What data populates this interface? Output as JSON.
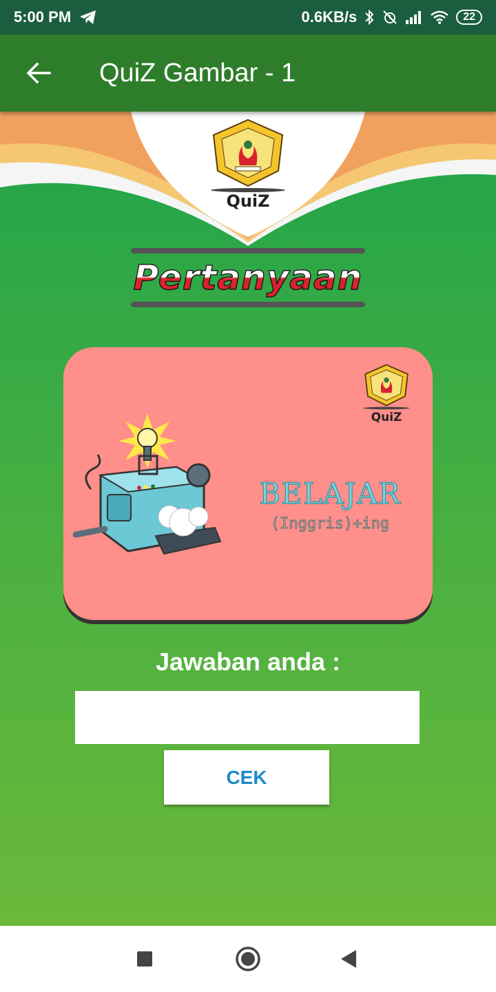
{
  "status_bar": {
    "time": "5:00 PM",
    "network_speed": "0.6KB/s",
    "battery": "22",
    "icons": [
      "telegram-icon",
      "bluetooth-icon",
      "alarm-off-icon",
      "signal-icon",
      "wifi-icon",
      "battery-icon"
    ]
  },
  "app_bar": {
    "title": "QuiZ Gambar - 1",
    "back_icon": "arrow-left-icon"
  },
  "header": {
    "logo_caption": "QuiZ",
    "banner_title": "Pertanyaan"
  },
  "card": {
    "logo_caption": "QuiZ",
    "word": "BELAJAR",
    "formula": "(Inggris)+ing"
  },
  "answer": {
    "label": "Jawaban anda :",
    "value": "",
    "placeholder": "",
    "submit_label": "CEK"
  },
  "nav_bar": {
    "icons": [
      "recent-apps-icon",
      "home-icon",
      "back-icon"
    ]
  },
  "colors": {
    "status_bar": "#1b5e3f",
    "app_bar": "#2e7d2a",
    "background_green": "#1fa44a",
    "card": "#ff8f8a",
    "button_text": "#1e88c8"
  }
}
